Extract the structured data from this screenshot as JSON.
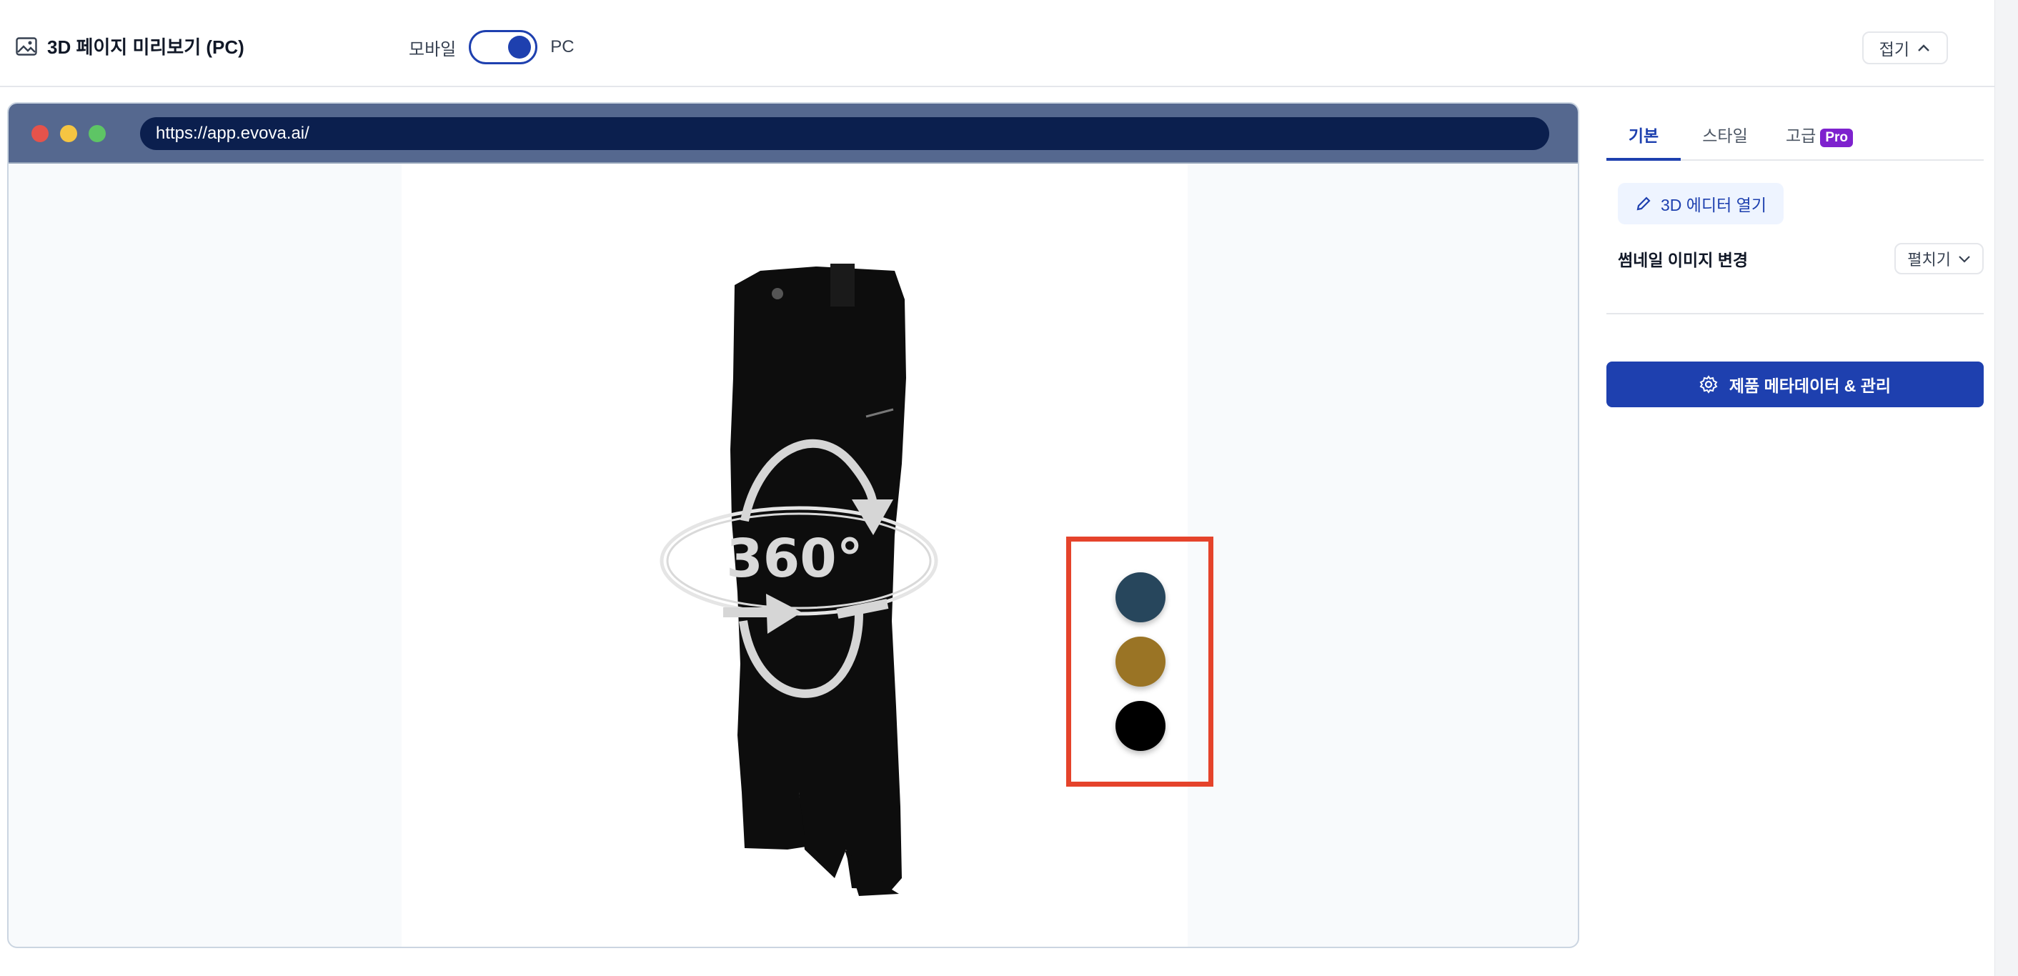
{
  "header": {
    "title": "3D 페이지 미리보기 (PC)",
    "toggle_left": "모바일",
    "toggle_right": "PC",
    "collapse_label": "접기"
  },
  "browser": {
    "url": "https://app.evova.ai/",
    "overlay_text": "360°",
    "swatches": [
      {
        "name": "navy",
        "color": "#27465c"
      },
      {
        "name": "mustard",
        "color": "#9a7425"
      },
      {
        "name": "black",
        "color": "#000000"
      }
    ]
  },
  "panel": {
    "tabs": [
      {
        "label": "기본",
        "active": true
      },
      {
        "label": "스타일",
        "active": false
      },
      {
        "label": "고급",
        "active": false,
        "badge": "Pro"
      }
    ],
    "editor_button": "3D 에디터 열기",
    "thumbnail_label": "썸네일 이미지 변경",
    "expand_label": "펼치기",
    "meta_button": "제품 메타데이터 & 관리"
  },
  "colors": {
    "accent": "#1e40af",
    "highlight": "#e5432b",
    "pro_badge": "#7e22ce"
  }
}
